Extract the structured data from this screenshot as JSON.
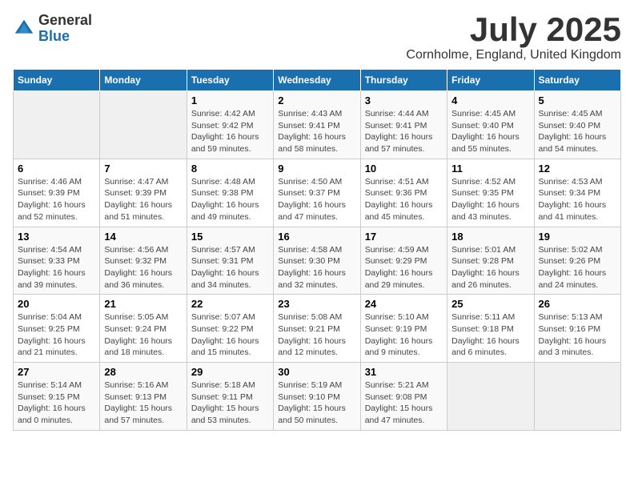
{
  "logo": {
    "general": "General",
    "blue": "Blue"
  },
  "title": {
    "month_year": "July 2025",
    "location": "Cornholme, England, United Kingdom"
  },
  "weekdays": [
    "Sunday",
    "Monday",
    "Tuesday",
    "Wednesday",
    "Thursday",
    "Friday",
    "Saturday"
  ],
  "weeks": [
    [
      {
        "day": "",
        "info": ""
      },
      {
        "day": "",
        "info": ""
      },
      {
        "day": "1",
        "info": "Sunrise: 4:42 AM\nSunset: 9:42 PM\nDaylight: 16 hours and 59 minutes."
      },
      {
        "day": "2",
        "info": "Sunrise: 4:43 AM\nSunset: 9:41 PM\nDaylight: 16 hours and 58 minutes."
      },
      {
        "day": "3",
        "info": "Sunrise: 4:44 AM\nSunset: 9:41 PM\nDaylight: 16 hours and 57 minutes."
      },
      {
        "day": "4",
        "info": "Sunrise: 4:45 AM\nSunset: 9:40 PM\nDaylight: 16 hours and 55 minutes."
      },
      {
        "day": "5",
        "info": "Sunrise: 4:45 AM\nSunset: 9:40 PM\nDaylight: 16 hours and 54 minutes."
      }
    ],
    [
      {
        "day": "6",
        "info": "Sunrise: 4:46 AM\nSunset: 9:39 PM\nDaylight: 16 hours and 52 minutes."
      },
      {
        "day": "7",
        "info": "Sunrise: 4:47 AM\nSunset: 9:39 PM\nDaylight: 16 hours and 51 minutes."
      },
      {
        "day": "8",
        "info": "Sunrise: 4:48 AM\nSunset: 9:38 PM\nDaylight: 16 hours and 49 minutes."
      },
      {
        "day": "9",
        "info": "Sunrise: 4:50 AM\nSunset: 9:37 PM\nDaylight: 16 hours and 47 minutes."
      },
      {
        "day": "10",
        "info": "Sunrise: 4:51 AM\nSunset: 9:36 PM\nDaylight: 16 hours and 45 minutes."
      },
      {
        "day": "11",
        "info": "Sunrise: 4:52 AM\nSunset: 9:35 PM\nDaylight: 16 hours and 43 minutes."
      },
      {
        "day": "12",
        "info": "Sunrise: 4:53 AM\nSunset: 9:34 PM\nDaylight: 16 hours and 41 minutes."
      }
    ],
    [
      {
        "day": "13",
        "info": "Sunrise: 4:54 AM\nSunset: 9:33 PM\nDaylight: 16 hours and 39 minutes."
      },
      {
        "day": "14",
        "info": "Sunrise: 4:56 AM\nSunset: 9:32 PM\nDaylight: 16 hours and 36 minutes."
      },
      {
        "day": "15",
        "info": "Sunrise: 4:57 AM\nSunset: 9:31 PM\nDaylight: 16 hours and 34 minutes."
      },
      {
        "day": "16",
        "info": "Sunrise: 4:58 AM\nSunset: 9:30 PM\nDaylight: 16 hours and 32 minutes."
      },
      {
        "day": "17",
        "info": "Sunrise: 4:59 AM\nSunset: 9:29 PM\nDaylight: 16 hours and 29 minutes."
      },
      {
        "day": "18",
        "info": "Sunrise: 5:01 AM\nSunset: 9:28 PM\nDaylight: 16 hours and 26 minutes."
      },
      {
        "day": "19",
        "info": "Sunrise: 5:02 AM\nSunset: 9:26 PM\nDaylight: 16 hours and 24 minutes."
      }
    ],
    [
      {
        "day": "20",
        "info": "Sunrise: 5:04 AM\nSunset: 9:25 PM\nDaylight: 16 hours and 21 minutes."
      },
      {
        "day": "21",
        "info": "Sunrise: 5:05 AM\nSunset: 9:24 PM\nDaylight: 16 hours and 18 minutes."
      },
      {
        "day": "22",
        "info": "Sunrise: 5:07 AM\nSunset: 9:22 PM\nDaylight: 16 hours and 15 minutes."
      },
      {
        "day": "23",
        "info": "Sunrise: 5:08 AM\nSunset: 9:21 PM\nDaylight: 16 hours and 12 minutes."
      },
      {
        "day": "24",
        "info": "Sunrise: 5:10 AM\nSunset: 9:19 PM\nDaylight: 16 hours and 9 minutes."
      },
      {
        "day": "25",
        "info": "Sunrise: 5:11 AM\nSunset: 9:18 PM\nDaylight: 16 hours and 6 minutes."
      },
      {
        "day": "26",
        "info": "Sunrise: 5:13 AM\nSunset: 9:16 PM\nDaylight: 16 hours and 3 minutes."
      }
    ],
    [
      {
        "day": "27",
        "info": "Sunrise: 5:14 AM\nSunset: 9:15 PM\nDaylight: 16 hours and 0 minutes."
      },
      {
        "day": "28",
        "info": "Sunrise: 5:16 AM\nSunset: 9:13 PM\nDaylight: 15 hours and 57 minutes."
      },
      {
        "day": "29",
        "info": "Sunrise: 5:18 AM\nSunset: 9:11 PM\nDaylight: 15 hours and 53 minutes."
      },
      {
        "day": "30",
        "info": "Sunrise: 5:19 AM\nSunset: 9:10 PM\nDaylight: 15 hours and 50 minutes."
      },
      {
        "day": "31",
        "info": "Sunrise: 5:21 AM\nSunset: 9:08 PM\nDaylight: 15 hours and 47 minutes."
      },
      {
        "day": "",
        "info": ""
      },
      {
        "day": "",
        "info": ""
      }
    ]
  ]
}
